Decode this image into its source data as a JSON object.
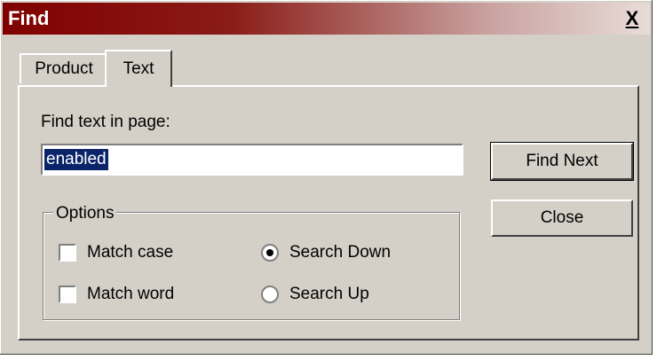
{
  "window": {
    "title": "Find",
    "close_label": "X"
  },
  "tabs": [
    {
      "label": "Product"
    },
    {
      "label": "Text"
    }
  ],
  "find": {
    "label": "Find text in page:",
    "value": "enabled"
  },
  "buttons": {
    "find_next": "Find Next",
    "close": "Close"
  },
  "options": {
    "legend": "Options",
    "match_case": {
      "label": "Match case",
      "checked": false
    },
    "match_word": {
      "label": "Match word",
      "checked": false
    },
    "search_down": {
      "label": "Search Down",
      "checked": true
    },
    "search_up": {
      "label": "Search Up",
      "checked": false
    }
  },
  "colors": {
    "title_start": "#800000",
    "selection": "#0a246a",
    "face": "#d4d0c8"
  }
}
